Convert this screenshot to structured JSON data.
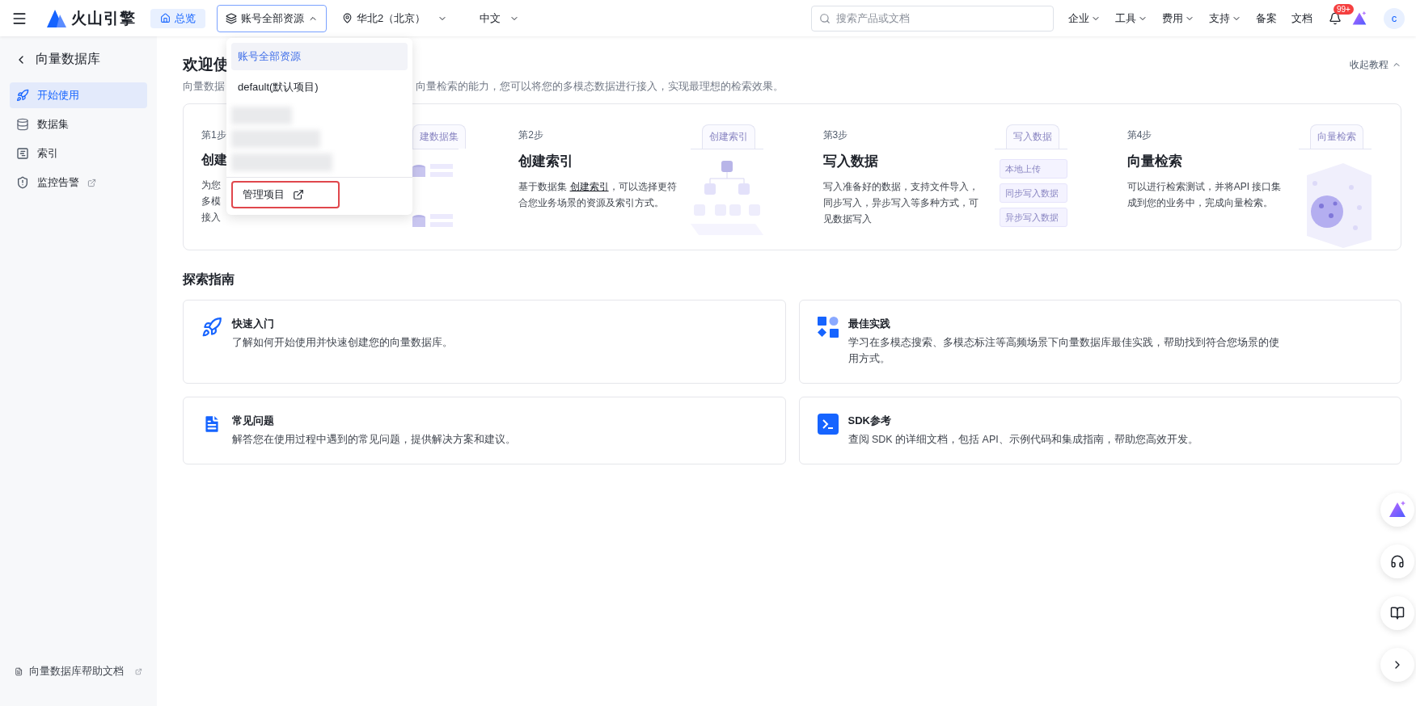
{
  "topbar": {
    "logo": "火山引擎",
    "home": "总览",
    "project": {
      "label": "账号全部资源",
      "expanded": true
    },
    "region": "华北2（北京）",
    "language": "中文",
    "search": {
      "placeholder": "搜索产品或文档"
    },
    "menus": [
      {
        "label": "企业",
        "dropdown": true
      },
      {
        "label": "工具",
        "dropdown": true
      },
      {
        "label": "费用",
        "dropdown": true
      },
      {
        "label": "支持",
        "dropdown": true
      },
      {
        "label": "备案",
        "dropdown": false
      },
      {
        "label": "文档",
        "dropdown": false
      }
    ],
    "notification_badge": "99+",
    "avatar": "c"
  },
  "sidebar": {
    "back_title": "向量数据库",
    "items": [
      {
        "kind": "rocket",
        "label": "开始使用",
        "selected": true,
        "external": false
      },
      {
        "kind": "database",
        "label": "数据集",
        "selected": false,
        "external": false
      },
      {
        "kind": "index",
        "label": "索引",
        "selected": false,
        "external": false
      },
      {
        "kind": "alarm",
        "label": "监控告警",
        "selected": false,
        "external": true
      }
    ],
    "help_link": "向量数据库帮助文档"
  },
  "welcome": {
    "title": "欢迎使",
    "intro_left": "向量数据",
    "intro_right": "向量检索的能力，您可以将您的多模态数据进行接入，实现最理想的检索效果。",
    "collapse": "收起教程"
  },
  "steps": [
    {
      "kind": "dataset",
      "step": "第1步",
      "title": "创建",
      "description_lines": [
        "为您",
        "多模",
        "接入"
      ],
      "tab": "建数据集"
    },
    {
      "kind": "index",
      "step": "第2步",
      "title": "创建索引",
      "description": {
        "before": "基于数据集 ",
        "link": "创建索引",
        "after": "，可以选择更符合您业务场景的资源及索引方式。"
      },
      "tab": "创建索引"
    },
    {
      "kind": "write",
      "step": "第3步",
      "title": "写入数据",
      "description": {
        "before": "写入准备好的数据，支持文件导入，同步写入，异步写入等多种方式，可见数据写入"
      },
      "tab": "写入数据",
      "options": [
        "本地上传",
        "同步写入数据",
        "异步写入数据"
      ]
    },
    {
      "kind": "search",
      "step": "第4步",
      "title": "向量检索",
      "description": {
        "before": "可以进行检索测试，并将API 接口集成到您的业务中，完成向量检索。"
      },
      "tab": "向量检索"
    }
  ],
  "guide": {
    "title": "探索指南",
    "cards": [
      {
        "kind": "rocket",
        "title": "快速入门",
        "description": "了解如何开始使用并快速创建您的向量数据库。"
      },
      {
        "kind": "shapes",
        "title": "最佳实践",
        "description": "学习在多模态搜索、多模态标注等高频场景下向量数据库最佳实践，帮助找到符合您场景的使用方式。"
      },
      {
        "kind": "document",
        "title": "常见问题",
        "description": "解答您在使用过程中遇到的常见问题，提供解决方案和建议。"
      },
      {
        "kind": "terminal",
        "title": "SDK参考",
        "description": "查阅 SDK 的详细文档，包括 API、示例代码和集成指南，帮助您高效开发。"
      }
    ]
  },
  "project_menu": {
    "items": [
      {
        "kind": "option",
        "label": "账号全部资源",
        "selected": true
      },
      {
        "kind": "option",
        "label": "default(默认项目)",
        "selected": false
      },
      {
        "kind": "blurred"
      },
      {
        "kind": "blurred"
      },
      {
        "kind": "blurred"
      }
    ],
    "manage": "管理项目",
    "manage_highlighted": true
  },
  "floating_buttons": [
    {
      "kind": "assistant"
    },
    {
      "kind": "support"
    },
    {
      "kind": "guide"
    },
    {
      "kind": "expand"
    }
  ]
}
